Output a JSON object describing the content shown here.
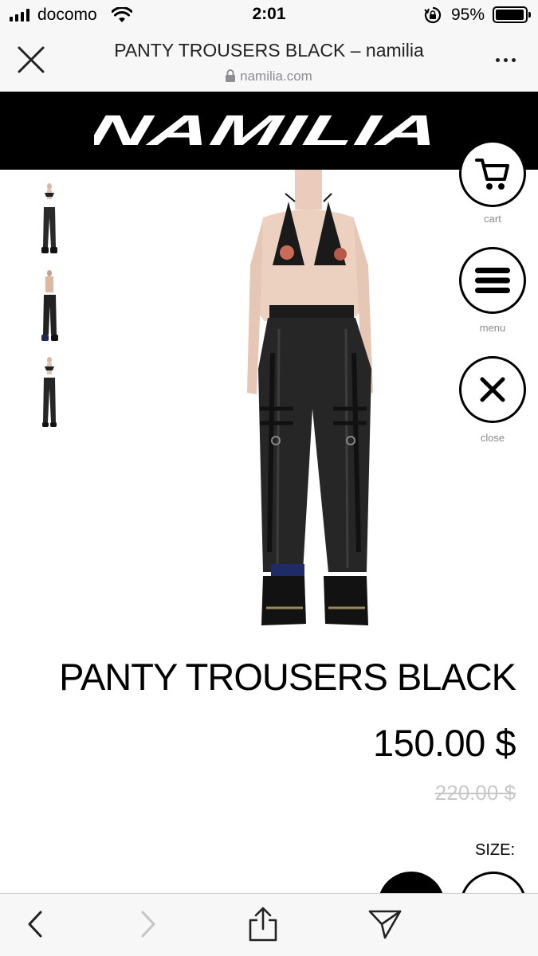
{
  "status_bar": {
    "carrier": "docomo",
    "time": "2:01",
    "battery_percent": "95%",
    "battery_level": 0.95,
    "icons": [
      "signal-icon",
      "wifi-icon",
      "rotation-lock-icon",
      "battery-icon"
    ]
  },
  "browser": {
    "page_title": "PANTY TROUSERS BLACK – namilia",
    "domain": "namilia.com",
    "icons": [
      "close-icon",
      "lock-icon",
      "more-icon"
    ]
  },
  "site": {
    "logo_text": "NAMILIA"
  },
  "product": {
    "name": "PANTY TROUSERS BLACK",
    "price": "150.00 $",
    "old_price": "220.00 $",
    "size_label": "SIZE:"
  },
  "actions": {
    "cart_label": "cart",
    "menu_label": "menu",
    "close_label": "close"
  },
  "toolbar": {
    "icons": [
      "back-icon",
      "forward-icon",
      "share-icon",
      "send-icon"
    ]
  },
  "colors": {
    "banner": "#000000",
    "chrome": "#f7f7f7",
    "muted_text": "#8e8e93",
    "old_price": "#c8c8c8"
  }
}
